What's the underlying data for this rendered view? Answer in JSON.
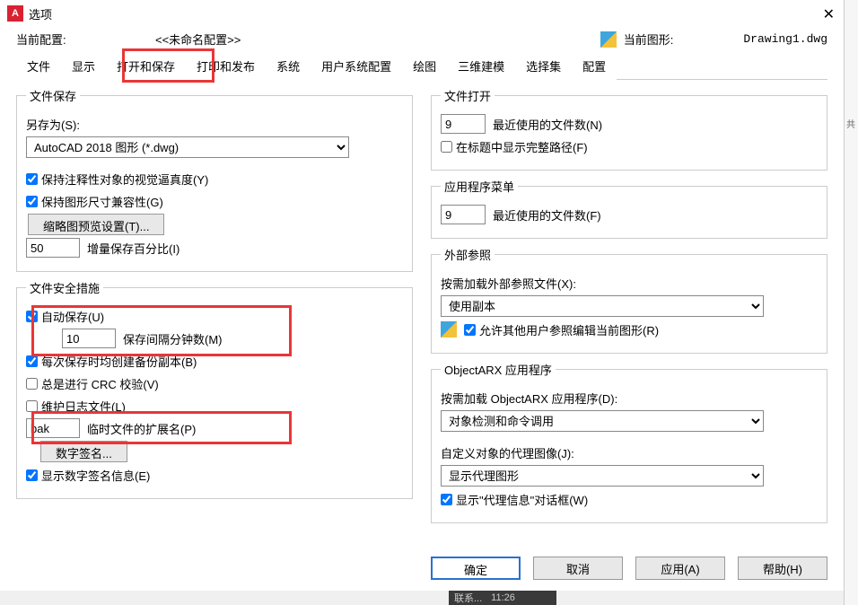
{
  "window": {
    "title": "选项"
  },
  "profile": {
    "label": "当前配置:",
    "value": "<<未命名配置>>"
  },
  "drawing": {
    "label": "当前图形:",
    "value": "Drawing1.dwg"
  },
  "tabs": [
    "文件",
    "显示",
    "打开和保存",
    "打印和发布",
    "系统",
    "用户系统配置",
    "绘图",
    "三维建模",
    "选择集",
    "配置"
  ],
  "fileSave": {
    "legend": "文件保存",
    "saveAsLabel": "另存为(S):",
    "saveAsSel": "AutoCAD 2018 图形 (*.dwg)",
    "annoVis": "保持注释性对象的视觉逼真度(Y)",
    "sizeCompat": "保持图形尺寸兼容性(G)",
    "thumbBtn": "缩略图预览设置(T)...",
    "incSave": "50",
    "incSaveLabel": "增量保存百分比(I)"
  },
  "fileSafe": {
    "legend": "文件安全措施",
    "autoSave": "自动保存(U)",
    "interval": "10",
    "intervalLabel": "保存间隔分钟数(M)",
    "backup": "每次保存时均创建备份副本(B)",
    "crc": "总是进行 CRC 校验(V)",
    "log": "维护日志文件(L)",
    "ext": "bak",
    "extLabel": "临时文件的扩展名(P)",
    "sigBtn": "数字签名...",
    "showSig": "显示数字签名信息(E)"
  },
  "fileOpen": {
    "legend": "文件打开",
    "recent": "9",
    "recentLabel": "最近使用的文件数(N)",
    "fullPath": "在标题中显示完整路径(F)"
  },
  "appMenu": {
    "legend": "应用程序菜单",
    "recent": "9",
    "recentLabel": "最近使用的文件数(F)"
  },
  "xref": {
    "legend": "外部参照",
    "loadLabel": "按需加载外部参照文件(X):",
    "loadSel": "使用副本",
    "allowEdit": "允许其他用户参照编辑当前图形(R)"
  },
  "arx": {
    "legend": "ObjectARX 应用程序",
    "loadLabel": "按需加载 ObjectARX 应用程序(D):",
    "loadSel": "对象检测和命令调用",
    "proxyLabel": "自定义对象的代理图像(J):",
    "proxySel": "显示代理图形",
    "showDlg": "显示\"代理信息\"对话框(W)"
  },
  "footer": {
    "ok": "确定",
    "cancel": "取消",
    "apply": "应用(A)",
    "help": "帮助(H)"
  },
  "stub": {
    "t": "联系...",
    "tm": "11:26"
  }
}
